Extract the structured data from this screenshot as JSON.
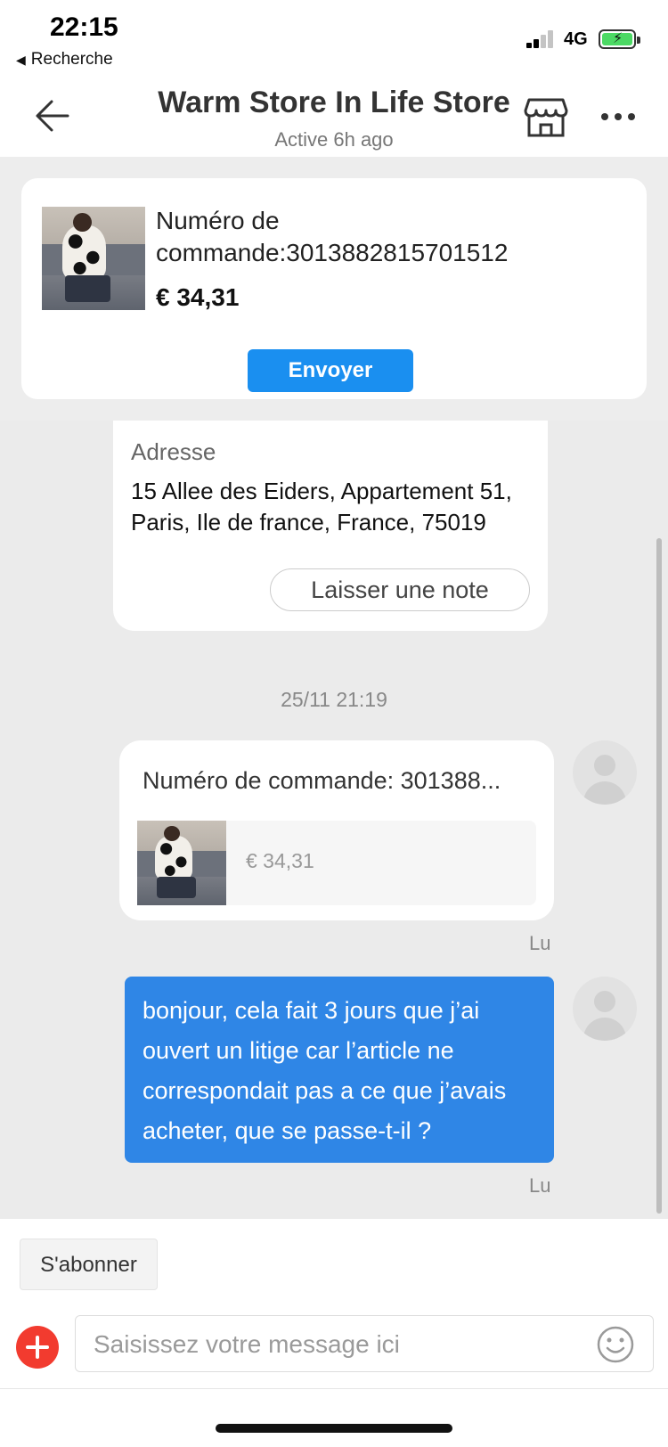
{
  "status_bar": {
    "time": "22:15",
    "back_app": "Recherche",
    "network": "4G",
    "icons": [
      "signal-icon",
      "battery-charging-icon"
    ]
  },
  "header": {
    "title": "Warm Store In Life Store",
    "subtitle": "Active 6h ago",
    "icons": [
      "back-arrow-icon",
      "store-icon",
      "more-icon"
    ]
  },
  "order_card": {
    "label": "Numéro de commande:3013882815701512",
    "price": "€ 34,31",
    "send_label": "Envoyer"
  },
  "address_card": {
    "label": "Adresse",
    "address": "15 Allee des Eiders, Appartement 51, Paris, Ile de france, France, 75019",
    "note_button": "Laisser une note"
  },
  "chat": {
    "timestamp": "25/11 21:19",
    "order_message": {
      "title": "Numéro de commande: 301388...",
      "price": "€ 34,31",
      "status": "Lu"
    },
    "text_message": {
      "text": "bonjour, cela fait 3 jours que j’ai ouvert un litige car l’article ne correspondait pas a ce que j’avais acheter, que se passe-t-il ?",
      "status": "Lu"
    }
  },
  "bottom_bar": {
    "subscribe_label": "S'abonner",
    "input_placeholder": "Saisissez votre message ici",
    "icons": [
      "plus-icon",
      "emoji-icon"
    ]
  },
  "colors": {
    "accent_blue": "#1a8ff0",
    "message_blue": "#2f86e6",
    "plus_red": "#f23b2f",
    "battery_green": "#4cd964"
  }
}
